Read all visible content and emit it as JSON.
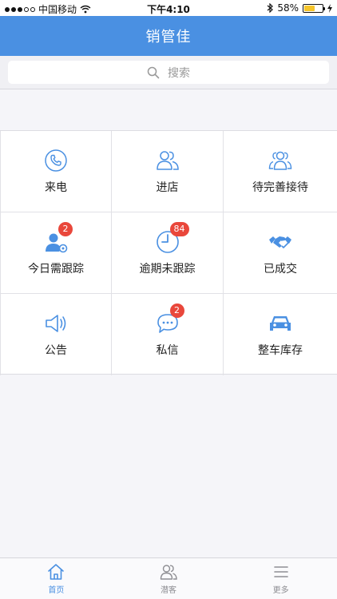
{
  "status_bar": {
    "carrier": "中国移动",
    "time": "下午4:10",
    "battery": "58%",
    "battery_level": 0.58,
    "icons": [
      "signal-icon",
      "wifi-icon",
      "bluetooth-icon",
      "battery-icon",
      "charging-icon"
    ]
  },
  "header": {
    "title": "销管佳"
  },
  "search": {
    "placeholder": "搜索",
    "icon": "search-icon"
  },
  "grid": [
    {
      "name": "incoming-call",
      "label": "来电",
      "icon": "phone-icon",
      "badge": ""
    },
    {
      "name": "store-visit",
      "label": "进店",
      "icon": "two-users-icon",
      "badge": ""
    },
    {
      "name": "pending-reception",
      "label": "待完善接待",
      "icon": "group-icon",
      "badge": ""
    },
    {
      "name": "today-follow-up",
      "label": "今日需跟踪",
      "icon": "user-settings-icon",
      "badge": "2"
    },
    {
      "name": "overdue-follow-up",
      "label": "逾期未跟踪",
      "icon": "clock-icon",
      "badge": "84"
    },
    {
      "name": "deal-closed",
      "label": "已成交",
      "icon": "handshake-icon",
      "badge": ""
    },
    {
      "name": "announcement",
      "label": "公告",
      "icon": "speaker-icon",
      "badge": ""
    },
    {
      "name": "private-message",
      "label": "私信",
      "icon": "chat-icon",
      "badge": "2"
    },
    {
      "name": "vehicle-inventory",
      "label": "整车库存",
      "icon": "car-icon",
      "badge": ""
    }
  ],
  "tab_bar": {
    "tabs": [
      {
        "label": "首页",
        "icon": "home-icon",
        "active": true
      },
      {
        "label": "潜客",
        "icon": "users-icon",
        "active": false
      },
      {
        "label": "更多",
        "icon": "menu-icon",
        "active": false
      }
    ]
  },
  "colors": {
    "accent": "#4a90e2",
    "icon": "#4a90e2",
    "badge": "#e9473b",
    "battery": "#f6c52a"
  }
}
